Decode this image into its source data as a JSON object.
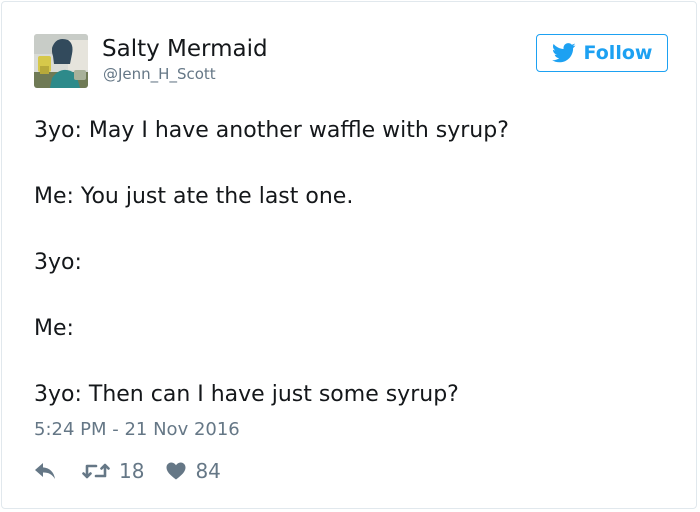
{
  "user": {
    "name": "Salty Mermaid",
    "handle": "@Jenn_H_Scott"
  },
  "follow_button": {
    "label": "Follow",
    "icon": "twitter-bird-icon"
  },
  "tweet": {
    "lines": [
      "3yo: May I have another waffle with syrup?",
      "Me: You just ate the last one.",
      "3yo:",
      "Me:",
      "3yo: Then can I have just some syrup?"
    ],
    "timestamp": "5:24 PM - 21 Nov 2016"
  },
  "actions": {
    "reply_icon": "reply-icon",
    "retweet_icon": "retweet-icon",
    "retweet_count": "18",
    "like_icon": "heart-icon",
    "like_count": "84"
  },
  "colors": {
    "brand": "#1da1f2",
    "text": "#14171a",
    "muted": "#657786",
    "border": "#e1e8ed"
  }
}
